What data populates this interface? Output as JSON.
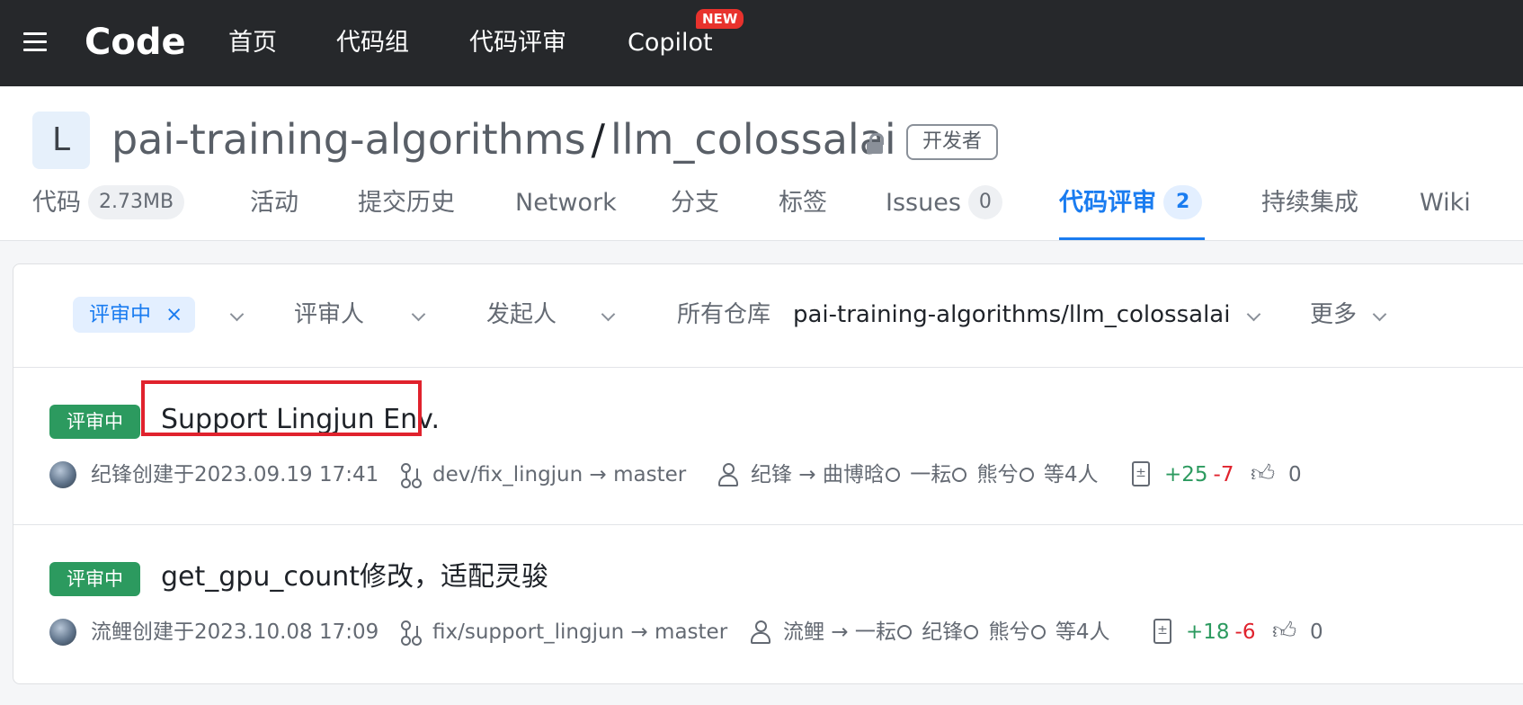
{
  "topbar": {
    "logo": "Code",
    "nav": [
      "首页",
      "代码组",
      "代码评审",
      "Copilot"
    ],
    "new_badge": "NEW"
  },
  "repo": {
    "avatar_letter": "L",
    "group": "pai-training-algorithms",
    "separator": "/",
    "name": "llm_colossalai",
    "role_tag": "开发者"
  },
  "tabs": [
    {
      "label": "代码",
      "count": "2.73MB"
    },
    {
      "label": "活动"
    },
    {
      "label": "提交历史"
    },
    {
      "label": "Network"
    },
    {
      "label": "分支"
    },
    {
      "label": "标签"
    },
    {
      "label": "Issues",
      "count": "0"
    },
    {
      "label": "代码评审",
      "count": "2",
      "active": true
    },
    {
      "label": "持续集成"
    },
    {
      "label": "Wiki"
    }
  ],
  "filters": {
    "status_chip": "评审中",
    "chip_close": "×",
    "reviewer": "评审人",
    "author": "发起人",
    "repo_label": "所有仓库",
    "repo_value": "pai-training-algorithms/llm_colossalai",
    "more": "更多"
  },
  "merge_requests": [
    {
      "status": "评审中",
      "title": "Support Lingjun Env.",
      "created": "纪锋创建于2023.09.19 17:41",
      "branch": "dev/fix_lingjun → master",
      "author": "纪锋",
      "reviewers": [
        "曲博晗",
        "一耘",
        "熊兮"
      ],
      "reviewer_more": "等4人",
      "additions": "+25",
      "deletions": "-7",
      "likes": "0"
    },
    {
      "status": "评审中",
      "title": "get_gpu_count修改，适配灵骏",
      "created": "流鲤创建于2023.10.08 17:09",
      "branch": "fix/support_lingjun → master",
      "author": "流鲤",
      "reviewers": [
        "一耘",
        "纪锋",
        "熊兮"
      ],
      "reviewer_more": "等4人",
      "additions": "+18",
      "deletions": "-6",
      "likes": "0"
    }
  ],
  "colors": {
    "topbar": "#26282b",
    "accent": "#1a7cf0",
    "status_green": "#2c9a5f",
    "deletion_red": "#e0222d",
    "highlight_box": "#e0222d"
  }
}
